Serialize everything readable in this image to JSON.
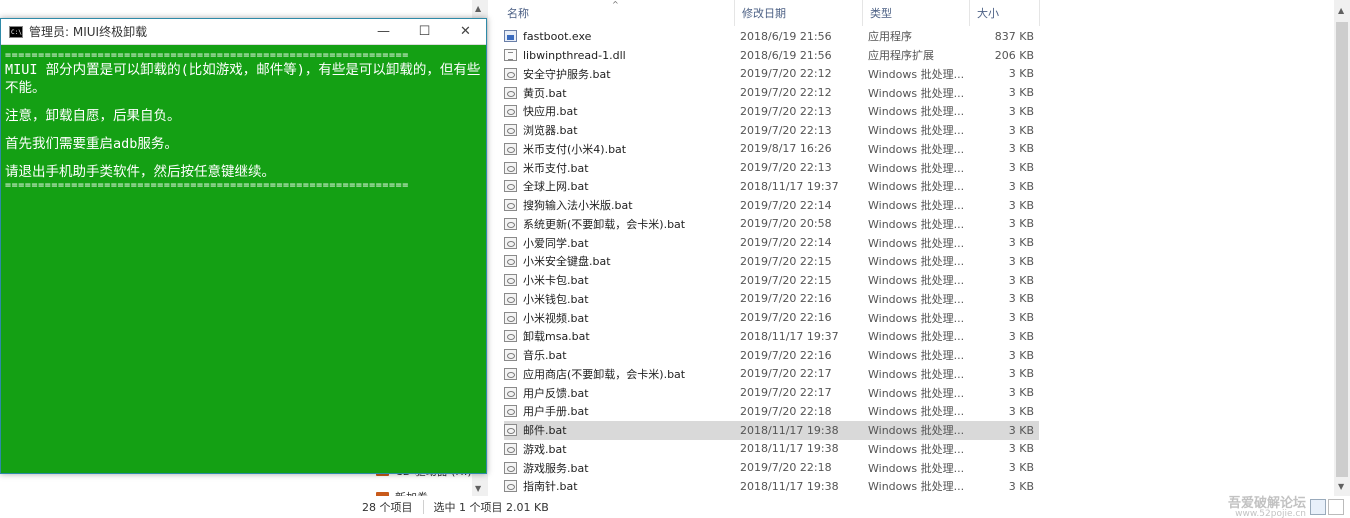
{
  "console": {
    "title": "管理员:  MIUI终极卸载",
    "separator": "=============================================================",
    "lines": [
      "MIUI 部分内置是可以卸载的(比如游戏，邮件等)，有些是可以卸载的，但有些不能。",
      "注意，卸载自愿，后果自负。",
      "首先我们需要重启adb服务。",
      "请退出手机助手类软件，然后按任意键继续。"
    ],
    "minimize": "—",
    "maximize": "☐",
    "close": "✕"
  },
  "tree": {
    "item1": "CD 驱动器 (H:)",
    "item2": "新加卷"
  },
  "columns": {
    "name": "名称",
    "date": "修改日期",
    "type": "类型",
    "size": "大小"
  },
  "files": [
    {
      "name": "fastboot.exe",
      "date": "2018/6/19 21:56",
      "type": "应用程序",
      "size": "837 KB",
      "icon": "exe"
    },
    {
      "name": "libwinpthread-1.dll",
      "date": "2018/6/19 21:56",
      "type": "应用程序扩展",
      "size": "206 KB",
      "icon": "dll"
    },
    {
      "name": "安全守护服务.bat",
      "date": "2019/7/20 22:12",
      "type": "Windows 批处理...",
      "size": "3 KB",
      "icon": "bat"
    },
    {
      "name": "黄页.bat",
      "date": "2019/7/20 22:12",
      "type": "Windows 批处理...",
      "size": "3 KB",
      "icon": "bat"
    },
    {
      "name": "快应用.bat",
      "date": "2019/7/20 22:13",
      "type": "Windows 批处理...",
      "size": "3 KB",
      "icon": "bat"
    },
    {
      "name": "浏览器.bat",
      "date": "2019/7/20 22:13",
      "type": "Windows 批处理...",
      "size": "3 KB",
      "icon": "bat"
    },
    {
      "name": "米币支付(小米4).bat",
      "date": "2019/8/17 16:26",
      "type": "Windows 批处理...",
      "size": "3 KB",
      "icon": "bat"
    },
    {
      "name": "米币支付.bat",
      "date": "2019/7/20 22:13",
      "type": "Windows 批处理...",
      "size": "3 KB",
      "icon": "bat"
    },
    {
      "name": "全球上网.bat",
      "date": "2018/11/17 19:37",
      "type": "Windows 批处理...",
      "size": "3 KB",
      "icon": "bat"
    },
    {
      "name": "搜狗输入法小米版.bat",
      "date": "2019/7/20 22:14",
      "type": "Windows 批处理...",
      "size": "3 KB",
      "icon": "bat"
    },
    {
      "name": "系统更新(不要卸载，会卡米).bat",
      "date": "2019/7/20 20:58",
      "type": "Windows 批处理...",
      "size": "3 KB",
      "icon": "bat"
    },
    {
      "name": "小爱同学.bat",
      "date": "2019/7/20 22:14",
      "type": "Windows 批处理...",
      "size": "3 KB",
      "icon": "bat"
    },
    {
      "name": "小米安全键盘.bat",
      "date": "2019/7/20 22:15",
      "type": "Windows 批处理...",
      "size": "3 KB",
      "icon": "bat"
    },
    {
      "name": "小米卡包.bat",
      "date": "2019/7/20 22:15",
      "type": "Windows 批处理...",
      "size": "3 KB",
      "icon": "bat"
    },
    {
      "name": "小米钱包.bat",
      "date": "2019/7/20 22:16",
      "type": "Windows 批处理...",
      "size": "3 KB",
      "icon": "bat"
    },
    {
      "name": "小米视频.bat",
      "date": "2019/7/20 22:16",
      "type": "Windows 批处理...",
      "size": "3 KB",
      "icon": "bat"
    },
    {
      "name": "卸载msa.bat",
      "date": "2018/11/17 19:37",
      "type": "Windows 批处理...",
      "size": "3 KB",
      "icon": "bat"
    },
    {
      "name": "音乐.bat",
      "date": "2019/7/20 22:16",
      "type": "Windows 批处理...",
      "size": "3 KB",
      "icon": "bat"
    },
    {
      "name": "应用商店(不要卸载，会卡米).bat",
      "date": "2019/7/20 22:17",
      "type": "Windows 批处理...",
      "size": "3 KB",
      "icon": "bat"
    },
    {
      "name": "用户反馈.bat",
      "date": "2019/7/20 22:17",
      "type": "Windows 批处理...",
      "size": "3 KB",
      "icon": "bat"
    },
    {
      "name": "用户手册.bat",
      "date": "2019/7/20 22:18",
      "type": "Windows 批处理...",
      "size": "3 KB",
      "icon": "bat"
    },
    {
      "name": "邮件.bat",
      "date": "2018/11/17 19:38",
      "type": "Windows 批处理...",
      "size": "3 KB",
      "icon": "bat",
      "selected": true
    },
    {
      "name": "游戏.bat",
      "date": "2018/11/17 19:38",
      "type": "Windows 批处理...",
      "size": "3 KB",
      "icon": "bat"
    },
    {
      "name": "游戏服务.bat",
      "date": "2019/7/20 22:18",
      "type": "Windows 批处理...",
      "size": "3 KB",
      "icon": "bat"
    },
    {
      "name": "指南针.bat",
      "date": "2018/11/17 19:38",
      "type": "Windows 批处理...",
      "size": "3 KB",
      "icon": "bat"
    }
  ],
  "status": {
    "count": "28 个项目",
    "selected": "选中 1 个项目  2.01 KB"
  },
  "watermark": {
    "line1": "吾爱破解论坛",
    "line2": "www.52pojie.cn"
  }
}
